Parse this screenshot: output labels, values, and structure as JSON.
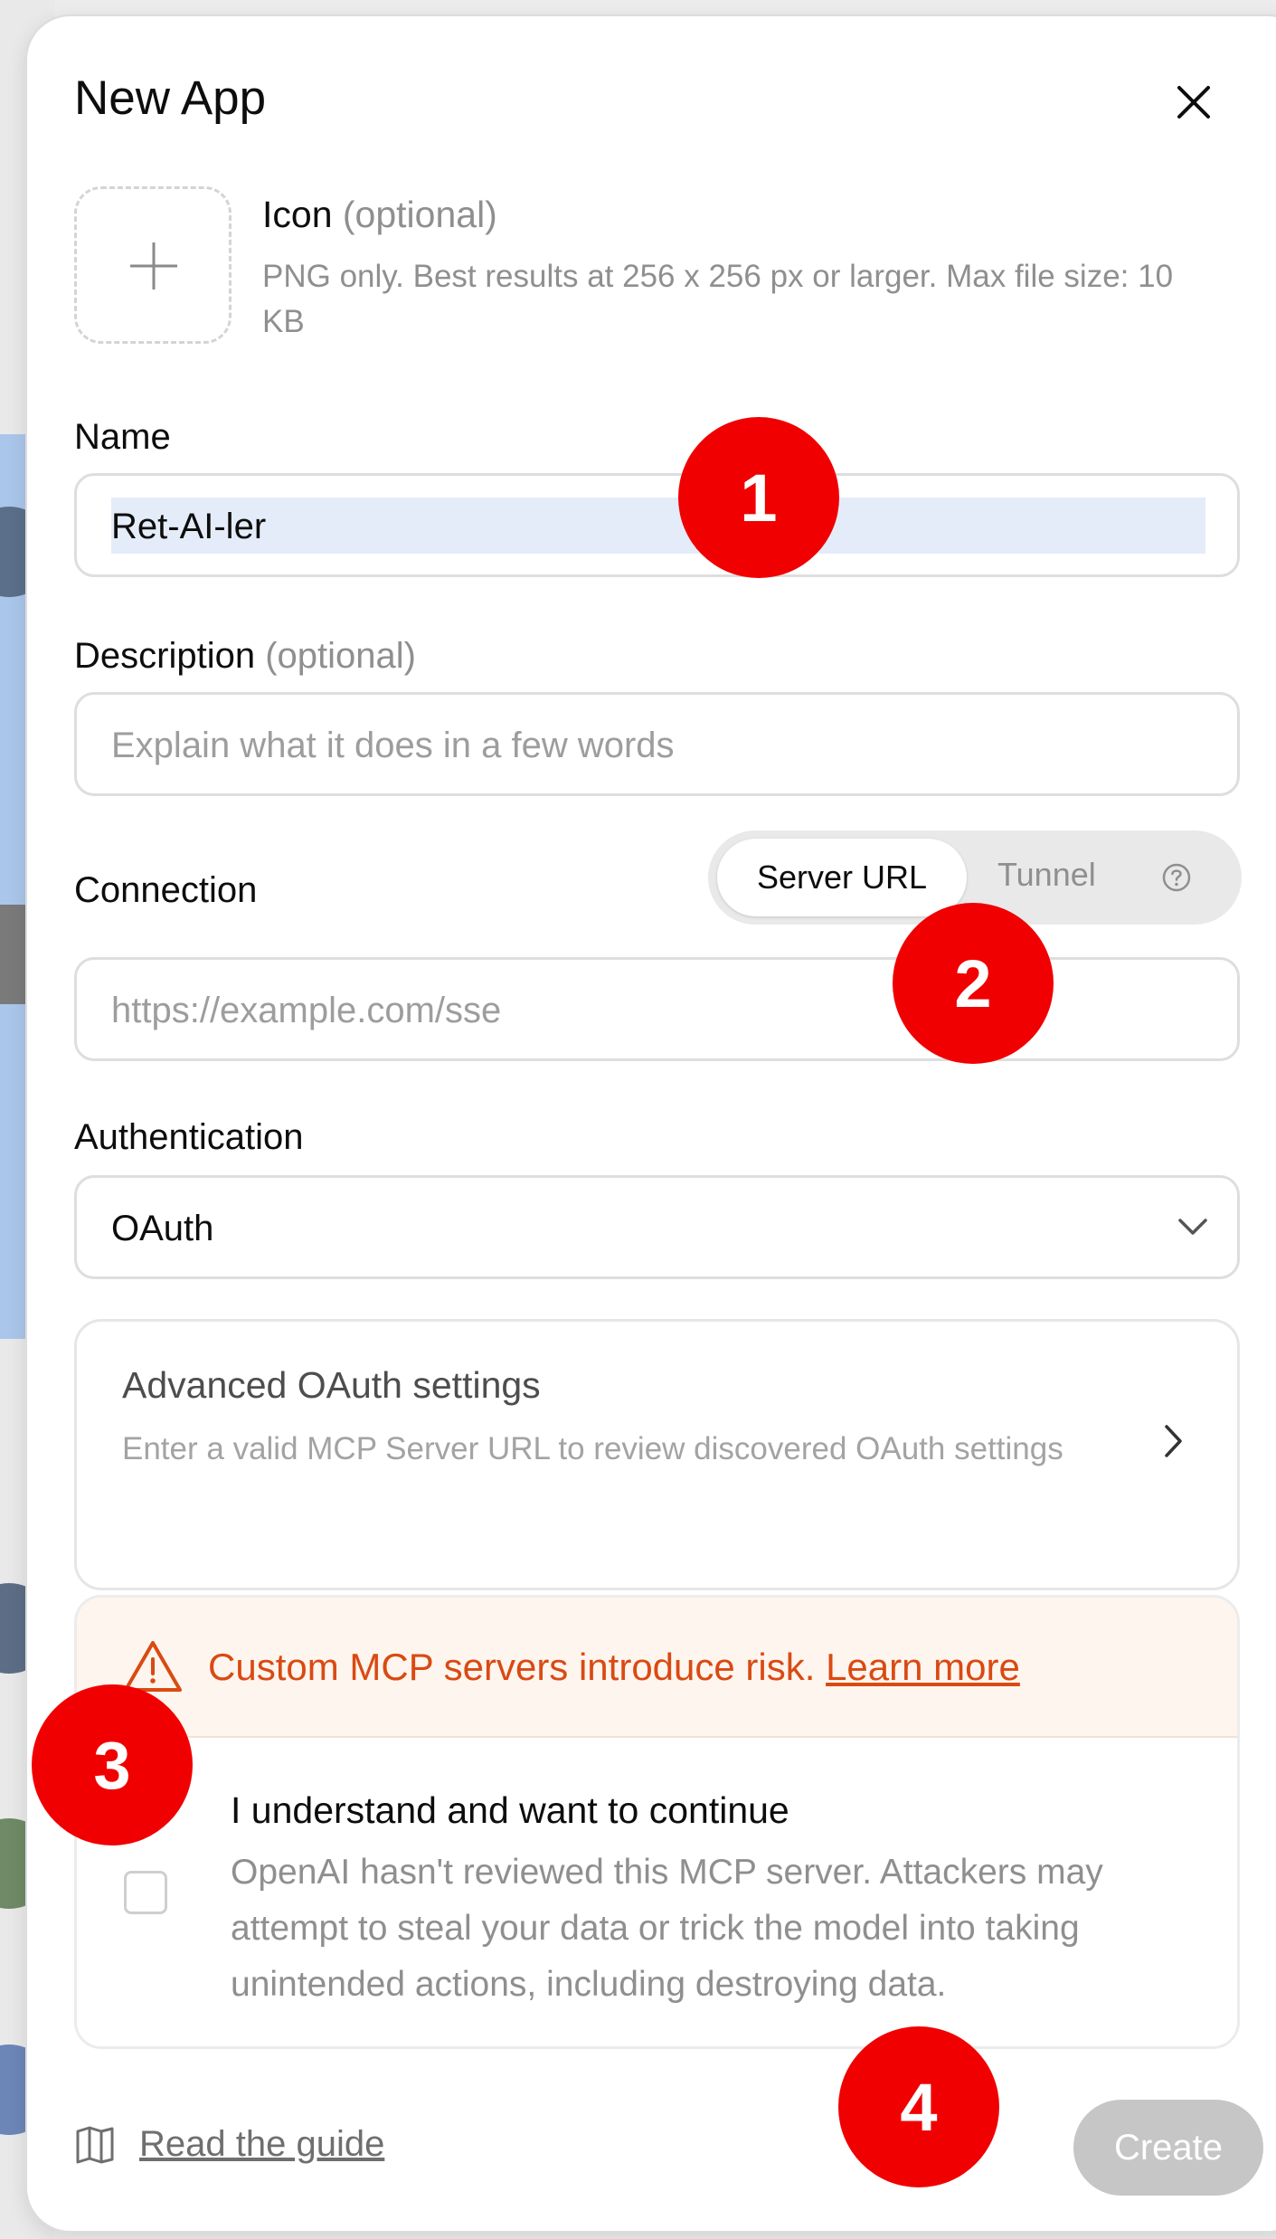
{
  "dialog": {
    "title": "New App",
    "close_icon": "close-icon"
  },
  "icon_section": {
    "label": "Icon",
    "optional": "(optional)",
    "help": "PNG only. Best results at 256 x 256 px or larger. Max file size: 10 KB",
    "upload_icon": "plus-icon"
  },
  "name": {
    "label": "Name",
    "value": "Ret-AI-ler"
  },
  "description": {
    "label": "Description",
    "optional": "(optional)",
    "placeholder": "Explain what it does in a few words"
  },
  "connection": {
    "label": "Connection",
    "options": [
      "Server URL",
      "Tunnel"
    ],
    "selected": "Server URL",
    "placeholder": "https://example.com/sse",
    "help_icon": "help-circle-icon"
  },
  "authentication": {
    "label": "Authentication",
    "selected": "OAuth",
    "dropdown_icon": "chevron-down-icon"
  },
  "advanced": {
    "title": "Advanced OAuth settings",
    "description": "Enter a valid MCP Server URL to review discovered OAuth settings",
    "icon": "chevron-right-icon"
  },
  "risk": {
    "warning_icon": "warning-triangle-icon",
    "text": "Custom MCP servers introduce risk.",
    "link": "Learn more",
    "ack_title": "I understand and want to continue",
    "ack_description": "OpenAI hasn't reviewed this MCP server. Attackers may attempt to steal your data or trick the model into taking unintended actions, including destroying data.",
    "checked": false
  },
  "footer": {
    "guide_icon": "book-icon",
    "guide_label": "Read the guide",
    "create_label": "Create"
  },
  "markers": [
    "1",
    "2",
    "3",
    "4"
  ],
  "colors": {
    "marker": "#f00000",
    "warning": "#d94a12",
    "warning_bg": "#fef5ee",
    "create_disabled": "#c6c6c6",
    "selection": "#e4ecf9"
  }
}
